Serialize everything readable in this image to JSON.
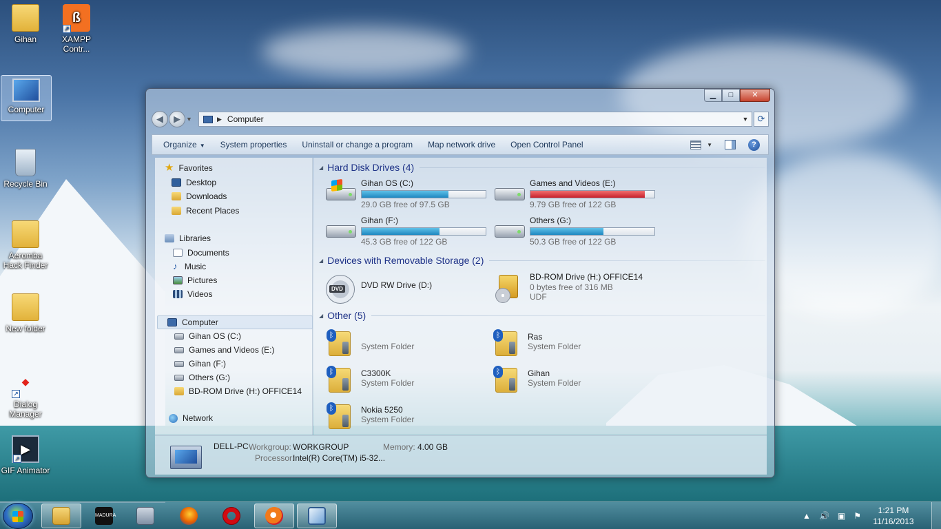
{
  "desktop": {
    "icons": [
      {
        "label": "Gihan",
        "icon": "user-folder-icon"
      },
      {
        "label": "XAMPP Contr...",
        "icon": "xampp-icon"
      },
      {
        "label": "Computer",
        "icon": "computer-icon"
      },
      {
        "label": "Recycle Bin",
        "icon": "recycle-bin-icon"
      },
      {
        "label": "Aeromba Hack Finder",
        "icon": "folder-icon"
      },
      {
        "label": "New folder",
        "icon": "folder-icon"
      },
      {
        "label": "Dialog Manager",
        "icon": "dialog-icon"
      },
      {
        "label": "GIF Animator",
        "icon": "gif-animator-icon"
      }
    ]
  },
  "window": {
    "address": "Computer",
    "commands": [
      "Organize",
      "System properties",
      "Uninstall or change a program",
      "Map network drive",
      "Open Control Panel"
    ]
  },
  "nav": {
    "favorites": {
      "label": "Favorites",
      "items": [
        "Desktop",
        "Downloads",
        "Recent Places"
      ]
    },
    "libraries": {
      "label": "Libraries",
      "items": [
        "Documents",
        "Music",
        "Pictures",
        "Videos"
      ]
    },
    "computer": {
      "label": "Computer",
      "items": [
        "Gihan OS (C:)",
        "Games and Videos (E:)",
        "Gihan (F:)",
        "Others (G:)",
        "BD-ROM Drive (H:) OFFICE14"
      ]
    },
    "network": {
      "label": "Network"
    }
  },
  "groups": {
    "hdd": "Hard Disk Drives (4)",
    "removable": "Devices with Removable Storage (2)",
    "other": "Other (5)"
  },
  "drives": [
    {
      "name": "Gihan OS (C:)",
      "free": "29.0 GB free of 97.5 GB",
      "used_fraction": 0.7,
      "critical": false,
      "system": true
    },
    {
      "name": "Games and Videos (E:)",
      "free": "9.79 GB free of 122 GB",
      "used_fraction": 0.92,
      "critical": true,
      "system": false
    },
    {
      "name": "Gihan (F:)",
      "free": "45.3 GB free of 122 GB",
      "used_fraction": 0.63,
      "critical": false,
      "system": false
    },
    {
      "name": "Others (G:)",
      "free": "50.3 GB free of 122 GB",
      "used_fraction": 0.59,
      "critical": false,
      "system": false
    }
  ],
  "removable": [
    {
      "name": "DVD RW Drive (D:)",
      "line2": "",
      "line3": "",
      "badge": "DVD"
    },
    {
      "name": "BD-ROM Drive (H:) OFFICE14",
      "line2": "0 bytes free of 316 MB",
      "line3": "UDF"
    }
  ],
  "other": [
    {
      "name": "",
      "type": "System Folder"
    },
    {
      "name": "Ras",
      "type": "System Folder"
    },
    {
      "name": "C3300K",
      "type": "System Folder"
    },
    {
      "name": "Gihan",
      "type": "System Folder"
    },
    {
      "name": "Nokia 5250",
      "type": "System Folder"
    }
  ],
  "details": {
    "pc_name": "DELL-PC",
    "workgroup_label": "Workgroup:",
    "workgroup": "WORKGROUP",
    "memory_label": "Memory:",
    "memory": "4.00 GB",
    "processor_label": "Processor:",
    "processor": "Intel(R) Core(TM) i5-32..."
  },
  "taskbar": {
    "time": "1:21 PM",
    "date": "11/16/2013",
    "madura_label": "MADURA"
  }
}
